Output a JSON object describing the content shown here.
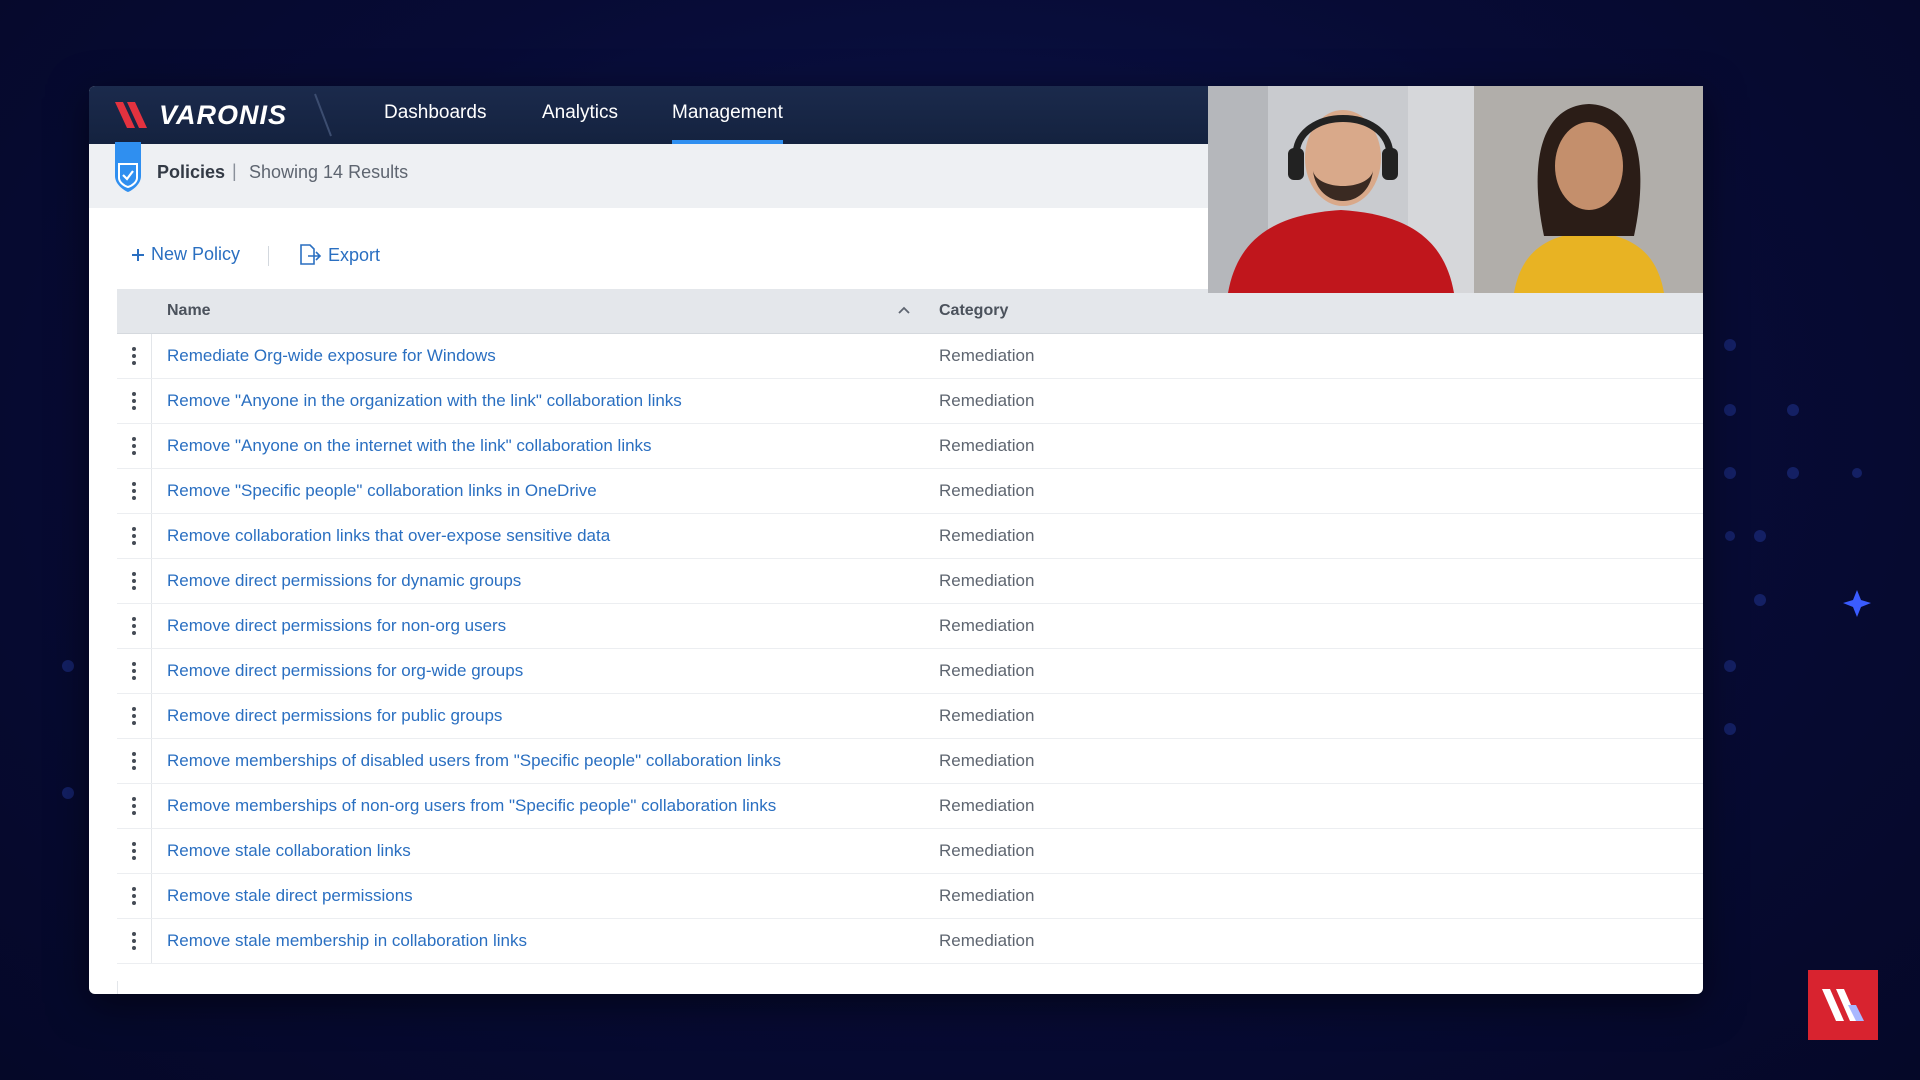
{
  "brand": {
    "name": "VARONIS"
  },
  "nav": {
    "items": [
      {
        "label": "Dashboards",
        "active": false
      },
      {
        "label": "Analytics",
        "active": false
      },
      {
        "label": "Management",
        "active": true
      }
    ]
  },
  "subheader": {
    "title": "Policies",
    "separator": "|",
    "count_text": "Showing 14 Results",
    "icon": "shield-check-icon"
  },
  "toolbar": {
    "new_policy": {
      "label": "New Policy",
      "icon": "plus-icon"
    },
    "export": {
      "label": "Export",
      "icon": "export-icon"
    }
  },
  "table": {
    "columns": [
      {
        "label": "Name",
        "sort": "ascending"
      },
      {
        "label": "Category"
      }
    ],
    "rows": [
      {
        "name": "Remediate Org-wide exposure for Windows",
        "category": "Remediation"
      },
      {
        "name": "Remove \"Anyone in the organization with the link\" collaboration links",
        "category": "Remediation"
      },
      {
        "name": "Remove \"Anyone on the internet with the link\" collaboration links",
        "category": "Remediation"
      },
      {
        "name": "Remove \"Specific people\" collaboration links in OneDrive",
        "category": "Remediation"
      },
      {
        "name": "Remove collaboration links that over-expose sensitive data",
        "category": "Remediation"
      },
      {
        "name": "Remove direct permissions for dynamic groups",
        "category": "Remediation"
      },
      {
        "name": "Remove direct permissions for non-org users",
        "category": "Remediation"
      },
      {
        "name": "Remove direct permissions for org-wide groups",
        "category": "Remediation"
      },
      {
        "name": "Remove direct permissions for public groups",
        "category": "Remediation"
      },
      {
        "name": "Remove memberships of disabled users from \"Specific people\" collaboration links",
        "category": "Remediation"
      },
      {
        "name": "Remove memberships of non-org users from \"Specific people\" collaboration links",
        "category": "Remediation"
      },
      {
        "name": "Remove stale collaboration links",
        "category": "Remediation"
      },
      {
        "name": "Remove stale direct permissions",
        "category": "Remediation"
      },
      {
        "name": "Remove stale membership in collaboration links",
        "category": "Remediation"
      }
    ]
  },
  "colors": {
    "nav_bg": "#14223f",
    "link": "#2a6fc1",
    "accent": "#2f8ff0",
    "brand_red": "#d8232f",
    "page_bg": "#070b35"
  }
}
